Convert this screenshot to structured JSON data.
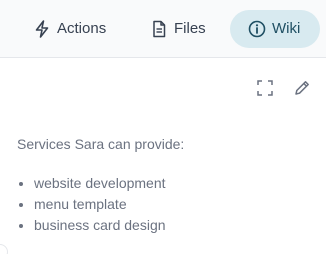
{
  "tabs": [
    {
      "label": "Actions",
      "icon": "lightning-bolt-icon"
    },
    {
      "label": "Files",
      "icon": "document-icon"
    },
    {
      "label": "Wiki",
      "icon": "info-circle-icon",
      "active": true
    }
  ],
  "toolbar": {
    "expand_icon": "expand-icon",
    "edit_icon": "pencil-icon"
  },
  "wiki": {
    "intro": "Services Sara can provide:",
    "services": [
      "website development",
      "menu template",
      "business card design"
    ]
  },
  "colors": {
    "active_tab_bg": "#d8eaf0",
    "active_tab_text": "#1f4f63",
    "text_muted": "#6b7280",
    "text_dark": "#374151"
  }
}
